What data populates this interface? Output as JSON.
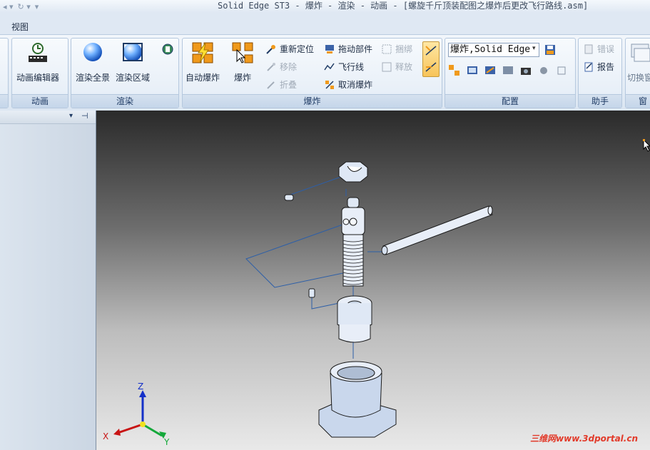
{
  "window": {
    "title": "Solid Edge ST3 - 爆炸 - 渲染 - 动画 - [螺旋千斤顶装配图之爆炸后更改飞行路线.asm]"
  },
  "menu": {
    "items": [
      "视图"
    ]
  },
  "ribbon": {
    "animation": {
      "label": "动画",
      "editor": "动画编辑器"
    },
    "render": {
      "label": "渲染",
      "full": "渲染全景",
      "region": "渲染区域"
    },
    "explode": {
      "label": "爆炸",
      "auto": "自动爆炸",
      "explode": "爆炸",
      "reposition": "重新定位",
      "move": "移除",
      "collapse": "折叠",
      "drag": "拖动部件",
      "flight": "飞行线",
      "cancel": "取消爆炸",
      "bind": "捆绑",
      "release": "释放"
    },
    "config": {
      "label": "配置",
      "combo_value": "爆炸,Solid Edge"
    },
    "assistant": {
      "label": "助手",
      "error": "错误",
      "report": "报告"
    },
    "window": {
      "label": "窗",
      "switch": "切换窗"
    }
  },
  "viewport": {
    "axis": {
      "x": "X",
      "y": "Y",
      "z": "Z"
    },
    "watermark": "三维网www.3dportal.cn"
  },
  "colors": {
    "accent": "#1e3a64",
    "flight_line": "#2d5fa8",
    "part": "#c9d7ec"
  }
}
